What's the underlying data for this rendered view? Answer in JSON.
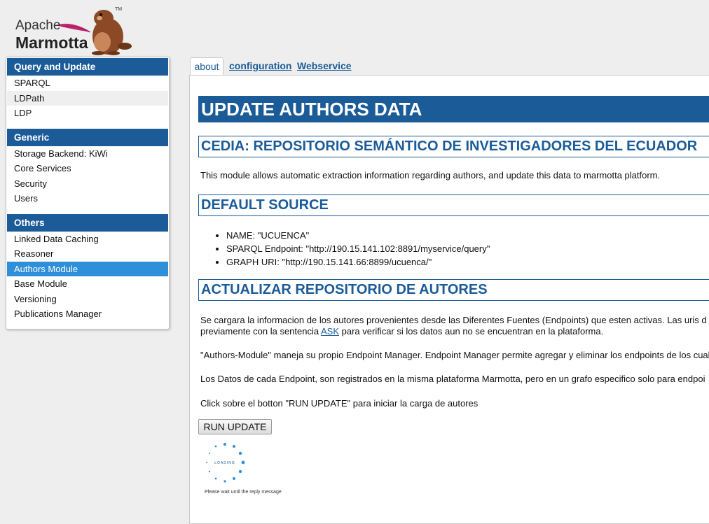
{
  "logo": {
    "line1": "Apache",
    "line2": "Marmotta",
    "tm": "TM"
  },
  "sidebar": {
    "groups": [
      {
        "title": "Query and Update",
        "items": [
          "SPARQL",
          "LDPath",
          "LDP"
        ]
      },
      {
        "title": "Generic",
        "items": [
          "Storage Backend: KiWi",
          "Core Services",
          "Security",
          "Users"
        ]
      },
      {
        "title": "Others",
        "items": [
          "Linked Data Caching",
          "Reasoner",
          "Authors Module",
          "Base Module",
          "Versioning",
          "Publications Manager"
        ]
      }
    ],
    "hovered_item": "LDPath",
    "active_item": "Authors Module"
  },
  "tabs": {
    "about": "about",
    "configuration": "configuration",
    "webservice": "Webservice"
  },
  "main": {
    "title": "UPDATE AUTHORS DATA",
    "section1_title": "CEDIA: REPOSITORIO SEMÁNTICO DE INVESTIGADORES DEL ECUADOR",
    "intro": "This module allows automatic extraction information regarding authors, and update this data to marmotta platform.",
    "section2_title": "DEFAULT SOURCE",
    "sources": [
      "NAME: \"UCUENCA\"",
      "SPARQL Endpoint: \"http://190.15.141.102:8891/myservice/query\"",
      "GRAPH URI: \"http://190.15.141.66:8899/ucuenca/\""
    ],
    "section3_title": "ACTUALIZAR REPOSITORIO DE AUTORES",
    "p1_line1": "Se cargara la informacion de los autores provenientes desde las Diferentes Fuentes (Endpoints) que esten activas. Las uris d",
    "p1_line2_pre": "previamente con la sentencia ",
    "p1_link": "ASK",
    "p1_line2_post": " para verificar si los datos aun no se encuentran en la plataforma.",
    "p2": "\"Authors-Module\" maneja su propio Endpoint Manager. Endpoint Manager permite agregar y eliminar los endpoints de los cual",
    "p3": "Los Datos de cada Endpoint, son registrados en la misma plataforma Marmotta, pero en un grafo especifico solo para endpoi",
    "p4": "Click sobre el botton \"RUN UPDATE\" para iniciar la carga de autores",
    "run_button": "RUN UPDATE",
    "loading_label": "LOADING",
    "wait_text": "Please wait until the reply message"
  }
}
